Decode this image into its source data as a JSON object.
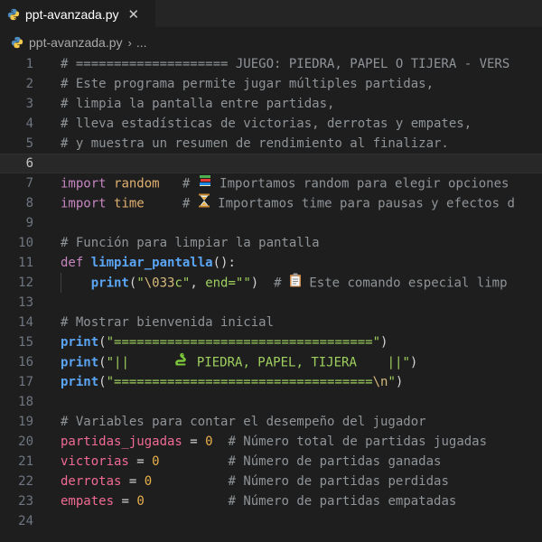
{
  "tab": {
    "filename": "ppt-avanzada.py",
    "close_symbol": "✕"
  },
  "breadcrumb": {
    "filename": "ppt-avanzada.py",
    "separator": "›",
    "ellipsis": "..."
  },
  "icons": {
    "file_type": "python-icon",
    "books": "books-emoji-icon",
    "hourglass": "hourglass-emoji-icon",
    "clipboard": "clipboard-emoji-icon",
    "snake": "snake-emoji-icon"
  },
  "colors": {
    "background": "#1e1e1e",
    "keyword": "#c586c0",
    "function": "#5ba5f5",
    "string": "#9fd05f",
    "comment": "#8f9498",
    "variable": "#f06a94",
    "number": "#e8b04c"
  },
  "current_line": 6,
  "lines": [
    {
      "n": "1",
      "t": [
        {
          "c": "cm",
          "v": "# ==================== JUEGO: PIEDRA, PAPEL O TIJERA - VERS"
        }
      ]
    },
    {
      "n": "2",
      "t": [
        {
          "c": "cm",
          "v": "# Este programa permite jugar múltiples partidas,"
        }
      ]
    },
    {
      "n": "3",
      "t": [
        {
          "c": "cm",
          "v": "# limpia la pantalla entre partidas,"
        }
      ]
    },
    {
      "n": "4",
      "t": [
        {
          "c": "cm",
          "v": "# lleva estadísticas de victorias, derrotas y empates,"
        }
      ]
    },
    {
      "n": "5",
      "t": [
        {
          "c": "cm",
          "v": "# y muestra un resumen de rendimiento al finalizar."
        }
      ]
    },
    {
      "n": "6",
      "t": []
    },
    {
      "n": "7",
      "t": [
        {
          "c": "kw",
          "v": "import"
        },
        {
          "c": "op",
          "v": " "
        },
        {
          "c": "mod",
          "v": "random"
        },
        {
          "c": "op",
          "v": "   "
        },
        {
          "c": "cm",
          "v": "# "
        },
        {
          "c": "emoji",
          "v": "books"
        },
        {
          "c": "cm",
          "v": " Importamos random para elegir opciones"
        }
      ]
    },
    {
      "n": "8",
      "t": [
        {
          "c": "kw",
          "v": "import"
        },
        {
          "c": "op",
          "v": " "
        },
        {
          "c": "mod",
          "v": "time"
        },
        {
          "c": "op",
          "v": "     "
        },
        {
          "c": "cm",
          "v": "# "
        },
        {
          "c": "emoji",
          "v": "hourglass"
        },
        {
          "c": "cm",
          "v": " Importamos time para pausas y efectos d"
        }
      ]
    },
    {
      "n": "9",
      "t": []
    },
    {
      "n": "10",
      "t": [
        {
          "c": "cm",
          "v": "# Función para limpiar la pantalla"
        }
      ]
    },
    {
      "n": "11",
      "t": [
        {
          "c": "kw",
          "v": "def"
        },
        {
          "c": "op",
          "v": " "
        },
        {
          "c": "fn",
          "v": "limpiar_pantalla"
        },
        {
          "c": "op",
          "v": "():"
        }
      ]
    },
    {
      "n": "12",
      "t": [
        {
          "c": "op",
          "v": "    "
        },
        {
          "c": "fn",
          "v": "print"
        },
        {
          "c": "op",
          "v": "("
        },
        {
          "c": "str",
          "v": "\""
        },
        {
          "c": "esc",
          "v": "\\033"
        },
        {
          "c": "str",
          "v": "c\""
        },
        {
          "c": "op",
          "v": ", "
        },
        {
          "c": "str",
          "v": "end=\"\""
        },
        {
          "c": "op",
          "v": ")  "
        },
        {
          "c": "cm",
          "v": "# "
        },
        {
          "c": "emoji",
          "v": "clipboard"
        },
        {
          "c": "cm",
          "v": " Este comando especial limp"
        }
      ]
    },
    {
      "n": "13",
      "t": []
    },
    {
      "n": "14",
      "t": [
        {
          "c": "cm",
          "v": "# Mostrar bienvenida inicial"
        }
      ]
    },
    {
      "n": "15",
      "t": [
        {
          "c": "fn",
          "v": "print"
        },
        {
          "c": "op",
          "v": "("
        },
        {
          "c": "str",
          "v": "\"==================================\""
        },
        {
          "c": "op",
          "v": ")"
        }
      ]
    },
    {
      "n": "16",
      "t": [
        {
          "c": "fn",
          "v": "print"
        },
        {
          "c": "op",
          "v": "("
        },
        {
          "c": "str",
          "v": "\"||      "
        },
        {
          "c": "emoji",
          "v": "snake"
        },
        {
          "c": "str",
          "v": " PIEDRA, PAPEL, TIJERA    ||\""
        },
        {
          "c": "op",
          "v": ")"
        }
      ]
    },
    {
      "n": "17",
      "t": [
        {
          "c": "fn",
          "v": "print"
        },
        {
          "c": "op",
          "v": "("
        },
        {
          "c": "str",
          "v": "\"=================================="
        },
        {
          "c": "esc",
          "v": "\\n"
        },
        {
          "c": "str",
          "v": "\""
        },
        {
          "c": "op",
          "v": ")"
        }
      ]
    },
    {
      "n": "18",
      "t": []
    },
    {
      "n": "19",
      "t": [
        {
          "c": "cm",
          "v": "# Variables para contar el desempeño del jugador"
        }
      ]
    },
    {
      "n": "20",
      "t": [
        {
          "c": "var",
          "v": "partidas_jugadas"
        },
        {
          "c": "op",
          "v": " = "
        },
        {
          "c": "num",
          "v": "0"
        },
        {
          "c": "op",
          "v": "  "
        },
        {
          "c": "cm",
          "v": "# Número total de partidas jugadas"
        }
      ]
    },
    {
      "n": "21",
      "t": [
        {
          "c": "var",
          "v": "victorias"
        },
        {
          "c": "op",
          "v": " = "
        },
        {
          "c": "num",
          "v": "0"
        },
        {
          "c": "op",
          "v": "         "
        },
        {
          "c": "cm",
          "v": "# Número de partidas ganadas"
        }
      ]
    },
    {
      "n": "22",
      "t": [
        {
          "c": "var",
          "v": "derrotas"
        },
        {
          "c": "op",
          "v": " = "
        },
        {
          "c": "num",
          "v": "0"
        },
        {
          "c": "op",
          "v": "          "
        },
        {
          "c": "cm",
          "v": "# Número de partidas perdidas"
        }
      ]
    },
    {
      "n": "23",
      "t": [
        {
          "c": "var",
          "v": "empates"
        },
        {
          "c": "op",
          "v": " = "
        },
        {
          "c": "num",
          "v": "0"
        },
        {
          "c": "op",
          "v": "           "
        },
        {
          "c": "cm",
          "v": "# Número de partidas empatadas"
        }
      ]
    },
    {
      "n": "24",
      "t": []
    }
  ]
}
